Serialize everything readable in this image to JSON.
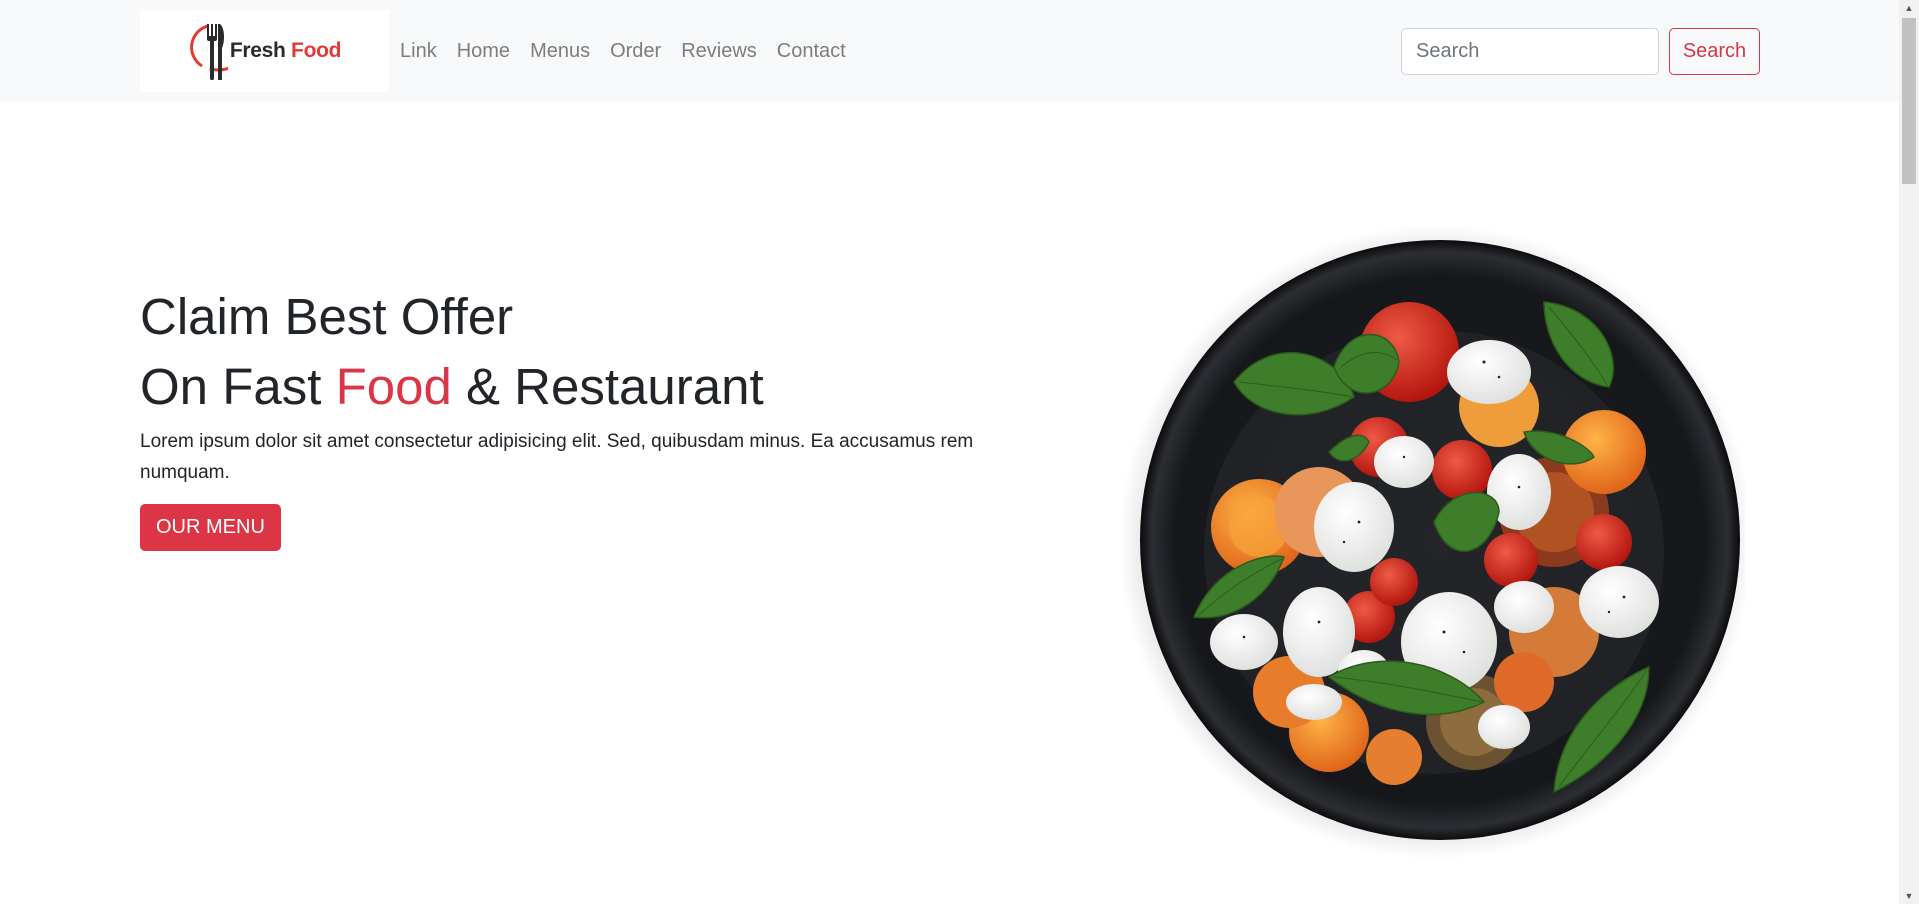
{
  "brand": {
    "word1": "Fresh",
    "word2": "Food",
    "primary_color": "#e53935",
    "icon": "fork-knife-icon"
  },
  "nav": {
    "items": [
      {
        "label": "Link"
      },
      {
        "label": "Home"
      },
      {
        "label": "Menus"
      },
      {
        "label": "Order"
      },
      {
        "label": "Reviews"
      },
      {
        "label": "Contact"
      }
    ]
  },
  "search": {
    "placeholder": "Search",
    "value": "",
    "button_label": "Search"
  },
  "hero": {
    "title_line1": "Claim Best Offer",
    "title_line2_prefix": "On Fast ",
    "title_line2_accent": "Food",
    "title_line2_suffix": " & Restaurant",
    "description": "Lorem ipsum dolor sit amet consectetur adipisicing elit. Sed, quibusdam minus. Ea accusamus rem numquam.",
    "button_label": "OUR MENU",
    "accent_color": "#dc3545",
    "image": "salad-plate-image"
  }
}
